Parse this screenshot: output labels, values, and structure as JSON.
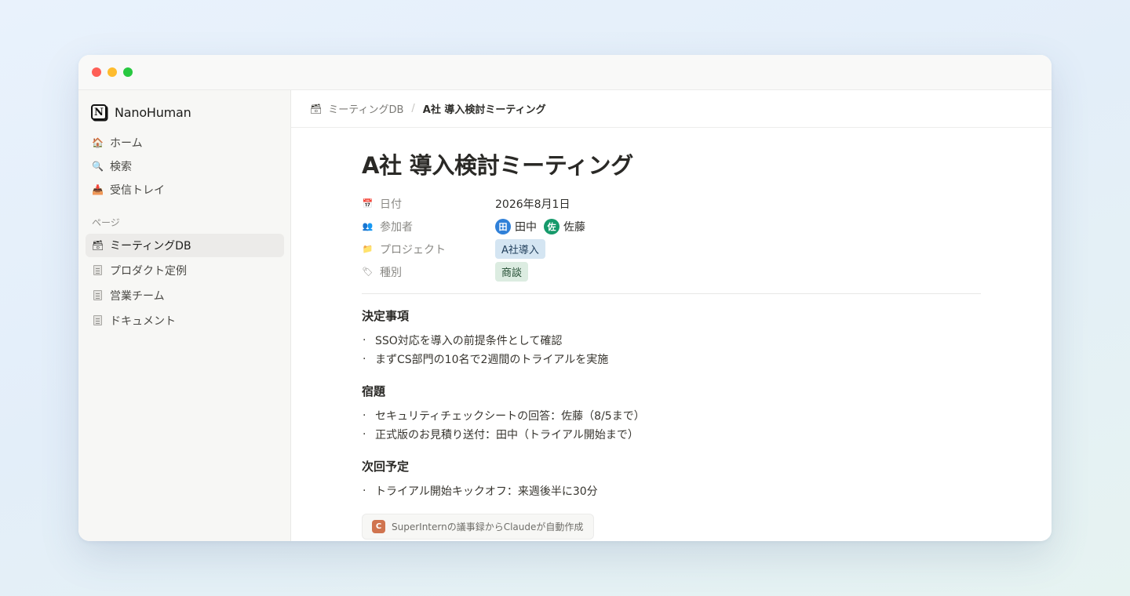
{
  "window": {
    "controls": [
      "close",
      "minimize",
      "maximize"
    ]
  },
  "sidebar": {
    "workspace": {
      "logo": "N",
      "name": "NanoHuman"
    },
    "top_items": [
      {
        "label": "ホーム",
        "icon": "🏠"
      },
      {
        "label": "検索",
        "icon": "🔍"
      },
      {
        "label": "受信トレイ",
        "icon": "📥"
      }
    ],
    "section_label": "ページ",
    "pages": [
      {
        "label": "ミーティングDB",
        "icon": "🗃",
        "active": true
      },
      {
        "label": "プロダクト定例",
        "icon": "page"
      },
      {
        "label": "営業チーム",
        "icon": "page"
      },
      {
        "label": "ドキュメント",
        "icon": "page"
      }
    ]
  },
  "breadcrumb": {
    "icon": "🗃",
    "parent": "ミーティングDB",
    "separator": "/",
    "current": "A社 導入検討ミーティング"
  },
  "page": {
    "title": "A社 導入検討ミーティング",
    "properties": {
      "date": {
        "icon": "📅",
        "label": "日付",
        "value": "2026年8月1日"
      },
      "attendees": {
        "icon": "👥",
        "label": "参加者",
        "people": [
          {
            "initial": "田",
            "name": "田中",
            "color": "#2f80d8"
          },
          {
            "initial": "佐",
            "name": "佐藤",
            "color": "#169a6b"
          }
        ]
      },
      "project": {
        "icon": "📁",
        "label": "プロジェクト",
        "value": "A社導入"
      },
      "category": {
        "icon": "🏷",
        "label": "種別",
        "value": "商談"
      }
    },
    "sections": [
      {
        "heading": "決定事項",
        "items": [
          "SSO対応を導入の前提条件として確認",
          "まずCS部門の10名で2週間のトライアルを実施"
        ]
      },
      {
        "heading": "宿題",
        "items": [
          "セキュリティチェックシートの回答：佐藤（8/5まで）",
          "正式版のお見積り送付：田中（トライアル開始まで）"
        ]
      },
      {
        "heading": "次回予定",
        "items": [
          "トライアル開始キックオフ：来週後半に30分"
        ]
      }
    ],
    "footer": {
      "badge": "C",
      "text": "SuperInternの議事録からClaudeが自動作成"
    }
  },
  "colors": {
    "tag_project_bg": "#d4e5f2",
    "tag_category_bg": "#dcece1",
    "active_nav_bg": "#ecebe9",
    "claude_badge": "#d0744f"
  }
}
